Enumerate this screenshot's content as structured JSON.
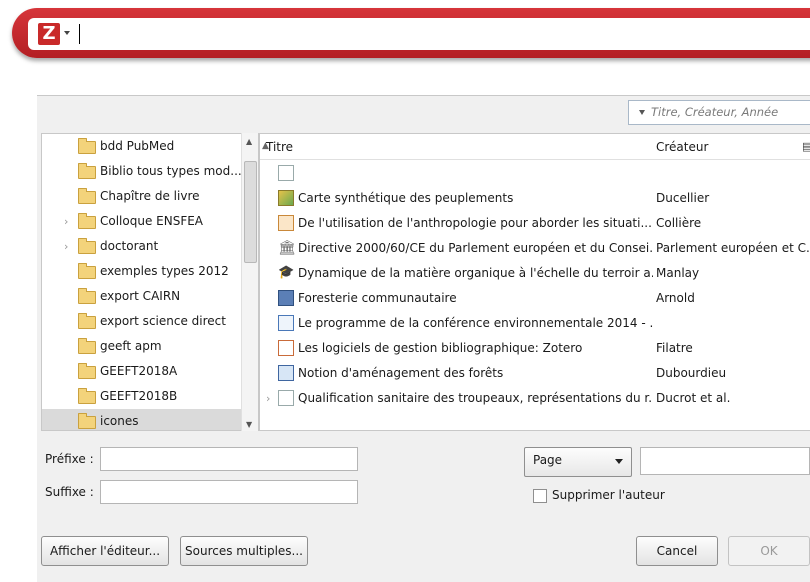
{
  "quickformat": {
    "logo": "Z",
    "menu_icon": "chevron-down-icon"
  },
  "search": {
    "placeholder": "Titre, Créateur, Année"
  },
  "collections": [
    {
      "label": "bdd PubMed",
      "expandable": false,
      "selected": false
    },
    {
      "label": "Biblio tous types mod...",
      "expandable": false,
      "selected": false
    },
    {
      "label": "Chapître de livre",
      "expandable": false,
      "selected": false
    },
    {
      "label": "Colloque ENSFEA",
      "expandable": true,
      "selected": false
    },
    {
      "label": "doctorant",
      "expandable": true,
      "selected": false
    },
    {
      "label": "exemples types 2012",
      "expandable": false,
      "selected": false
    },
    {
      "label": "export CAIRN",
      "expandable": false,
      "selected": false
    },
    {
      "label": "export science direct",
      "expandable": false,
      "selected": false
    },
    {
      "label": "geeft apm",
      "expandable": false,
      "selected": false
    },
    {
      "label": "GEEFT2018A",
      "expandable": false,
      "selected": false
    },
    {
      "label": "GEEFT2018B",
      "expandable": false,
      "selected": false
    },
    {
      "label": "icones",
      "expandable": false,
      "selected": true
    }
  ],
  "items_header": {
    "title": "Titre",
    "creator": "Créateur"
  },
  "items": [
    {
      "icon": "document-icon",
      "title": "",
      "creator": "",
      "expandable": false
    },
    {
      "icon": "map-icon",
      "title": "Carte synthétique des peuplements",
      "creator": "Ducellier",
      "expandable": false
    },
    {
      "icon": "presentation-icon",
      "title": "De l'utilisation de l'anthropologie pour aborder les situati...",
      "creator": "Collière",
      "expandable": false
    },
    {
      "icon": "statute-icon",
      "title": "Directive 2000/60/CE du Parlement européen et du Consei...",
      "creator": "Parlement européen et C...",
      "expandable": false
    },
    {
      "icon": "thesis-icon",
      "title": "Dynamique de la matière organique à l'échelle du terroir a...",
      "creator": "Manlay",
      "expandable": false
    },
    {
      "icon": "book-icon",
      "title": "Foresterie communautaire",
      "creator": "Arnold",
      "expandable": false
    },
    {
      "icon": "report-icon",
      "title": "Le programme de la conférence environnementale 2014 - ...",
      "creator": "",
      "expandable": false
    },
    {
      "icon": "journal-article-icon",
      "title": "Les logiciels de gestion bibliographique: Zotero",
      "creator": "Filatre",
      "expandable": false
    },
    {
      "icon": "book-section-icon",
      "title": "Notion d'aménagement des forêts",
      "creator": "Dubourdieu",
      "expandable": false
    },
    {
      "icon": "document-icon",
      "title": "Qualification sanitaire des troupeaux, représentations du r...",
      "creator": "Ducrot et al.",
      "expandable": true
    }
  ],
  "form": {
    "prefix_label": "Préfixe :",
    "suffix_label": "Suffixe :",
    "prefix_value": "",
    "suffix_value": "",
    "locator_type": "Page",
    "locator_value": "",
    "suppress_author_label": "Supprimer l'auteur",
    "suppress_author_checked": false
  },
  "buttons": {
    "show_editor": "Afficher l'éditeur...",
    "multiple_sources": "Sources multiples...",
    "cancel": "Cancel",
    "ok": "OK"
  }
}
